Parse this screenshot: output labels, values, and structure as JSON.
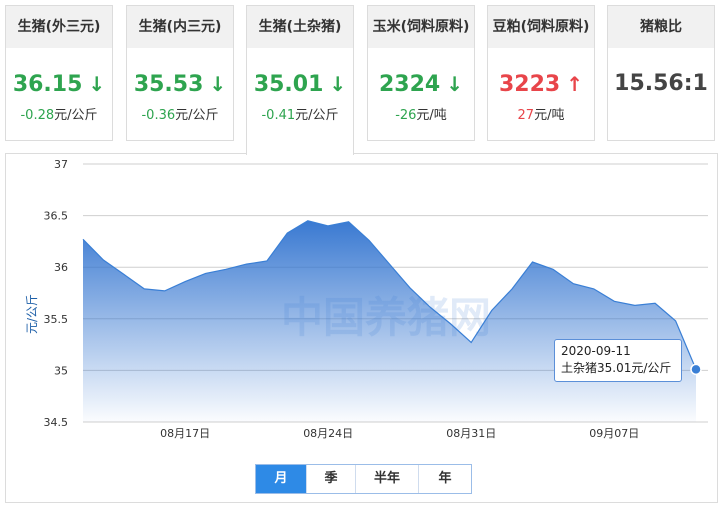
{
  "cards": [
    {
      "title": "生猪(外三元)",
      "value": "36.15",
      "dir": "down",
      "arrow": "↓",
      "change": "-0.28",
      "unit": "元/公斤"
    },
    {
      "title": "生猪(内三元)",
      "value": "35.53",
      "dir": "down",
      "arrow": "↓",
      "change": "-0.36",
      "unit": "元/公斤"
    },
    {
      "title": "生猪(土杂猪)",
      "value": "35.01",
      "dir": "down",
      "arrow": "↓",
      "change": "-0.41",
      "unit": "元/公斤"
    },
    {
      "title": "玉米(饲料原料)",
      "value": "2324",
      "dir": "down",
      "arrow": "↓",
      "change": "-26",
      "unit": "元/吨"
    },
    {
      "title": "豆粕(饲料原料)",
      "value": "3223",
      "dir": "up",
      "arrow": "↑",
      "change": "27",
      "unit": "元/吨"
    },
    {
      "title": "猪粮比",
      "value": "15.56:1",
      "dir": "neutral",
      "arrow": "",
      "change": "",
      "unit": ""
    }
  ],
  "active_card": 2,
  "colors": {
    "down": "#2ea44f",
    "up": "#e8454a",
    "line": "#3a7fd5",
    "accent": "#2e8ae6"
  },
  "watermark": "中国养猪网",
  "tooltip": {
    "date": "2020-09-11",
    "text": "土杂猪35.01元/公斤"
  },
  "range_buttons": [
    "月",
    "季",
    "半年",
    "年"
  ],
  "range_selected": 0,
  "chart_data": {
    "type": "area",
    "title": "",
    "xlabel": "",
    "ylabel": "元/公斤",
    "ylim": [
      34.5,
      37
    ],
    "yticks": [
      "37",
      "36.5",
      "36",
      "35.5",
      "35",
      "34.5"
    ],
    "xticks": [
      "08月17日",
      "08月24日",
      "08月31日",
      "09月07日"
    ],
    "x": [
      "2020-08-12",
      "2020-08-13",
      "2020-08-14",
      "2020-08-15",
      "2020-08-16",
      "2020-08-17",
      "2020-08-18",
      "2020-08-19",
      "2020-08-20",
      "2020-08-21",
      "2020-08-22",
      "2020-08-23",
      "2020-08-24",
      "2020-08-25",
      "2020-08-26",
      "2020-08-27",
      "2020-08-28",
      "2020-08-29",
      "2020-08-30",
      "2020-08-31",
      "2020-09-01",
      "2020-09-02",
      "2020-09-03",
      "2020-09-04",
      "2020-09-05",
      "2020-09-06",
      "2020-09-07",
      "2020-09-08",
      "2020-09-09",
      "2020-09-10",
      "2020-09-11"
    ],
    "series": [
      {
        "values": [
          36.27,
          36.07,
          35.93,
          35.79,
          35.77,
          35.86,
          35.94,
          35.98,
          36.03,
          36.06,
          36.33,
          36.45,
          36.4,
          36.44,
          36.26,
          36.03,
          35.8,
          35.61,
          35.45,
          35.27,
          35.58,
          35.79,
          36.05,
          35.98,
          35.84,
          35.79,
          35.67,
          35.63,
          35.65,
          35.48,
          35.01
        ]
      }
    ],
    "grid": true,
    "legend": "none"
  }
}
